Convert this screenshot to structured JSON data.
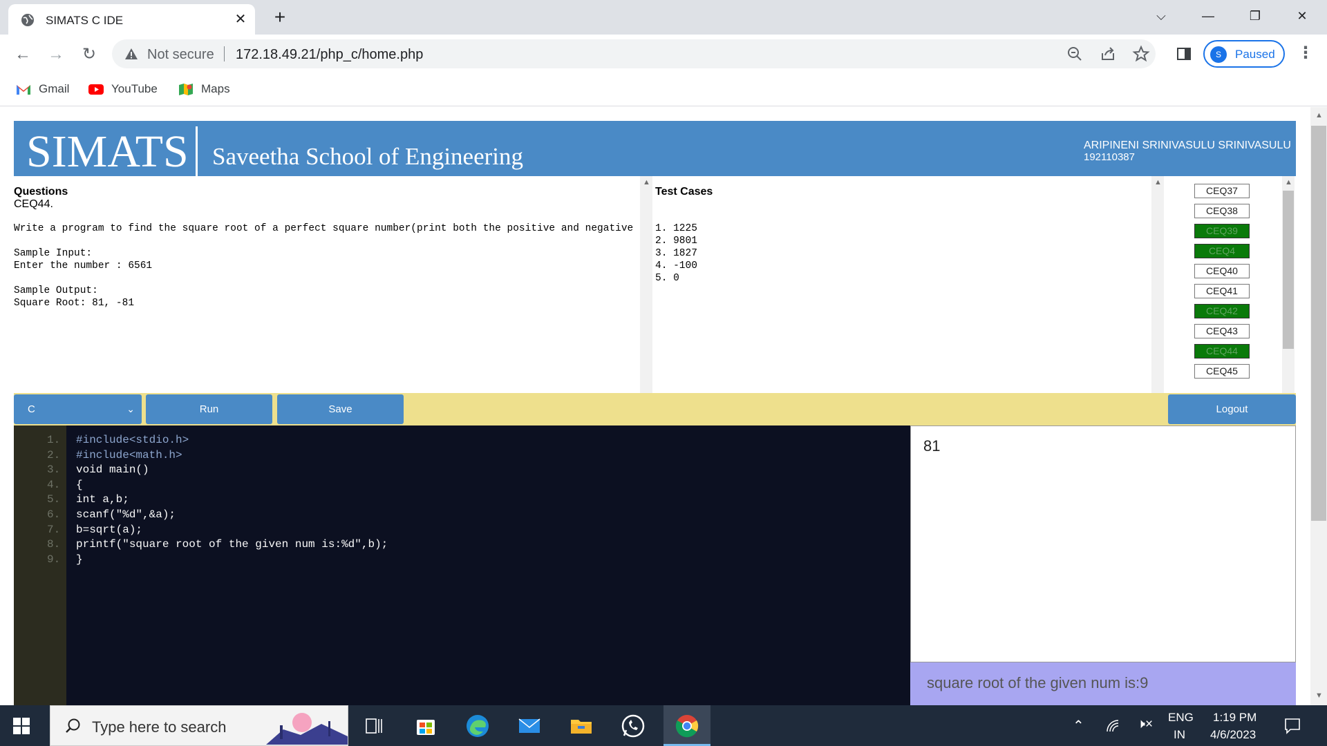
{
  "browser": {
    "tab_title": "SIMATS C IDE",
    "security_label": "Not secure",
    "url": "172.18.49.21/php_c/home.php",
    "profile_initial": "S",
    "profile_status": "Paused",
    "bookmarks": [
      {
        "label": "Gmail"
      },
      {
        "label": "YouTube"
      },
      {
        "label": "Maps"
      }
    ]
  },
  "header": {
    "brand": "SIMATS",
    "subtitle": "Saveetha School of Engineering",
    "user_name": "ARIPINENI SRINIVASULU SRINIVASULU",
    "user_id": "192110387"
  },
  "question": {
    "heading": "Questions",
    "id": "CEQ44.",
    "body": "Write a program to find the square root of a perfect square number(print both the positive and negative v\n\nSample Input:\nEnter the number : 6561\n\nSample Output:\nSquare Root: 81, -81"
  },
  "test_cases": {
    "heading": "Test Cases",
    "items": [
      "1. 1225",
      "2. 9801",
      "3. 1827",
      "4. -100",
      "5. 0"
    ]
  },
  "question_list": [
    {
      "label": "CEQ37",
      "status": "pending"
    },
    {
      "label": "CEQ38",
      "status": "pending"
    },
    {
      "label": "CEQ39",
      "status": "done"
    },
    {
      "label": "CEQ4",
      "status": "done"
    },
    {
      "label": "CEQ40",
      "status": "pending"
    },
    {
      "label": "CEQ41",
      "status": "pending"
    },
    {
      "label": "CEQ42",
      "status": "done"
    },
    {
      "label": "CEQ43",
      "status": "pending"
    },
    {
      "label": "CEQ44",
      "status": "done"
    },
    {
      "label": "CEQ45",
      "status": "pending"
    }
  ],
  "controls": {
    "language": "C",
    "run_label": "Run",
    "save_label": "Save",
    "logout_label": "Logout"
  },
  "editor": {
    "line_numbers": [
      "1.",
      "2.",
      "3.",
      "4.",
      "5.",
      "6.",
      "7.",
      "8.",
      "9."
    ],
    "lines": [
      "#include<stdio.h>",
      "#include<math.h>",
      "void main()",
      "{",
      "int a,b;",
      "scanf(\"%d\",&a);",
      "b=sqrt(a);",
      "printf(\"square root of the given num is:%d\",b);",
      "}"
    ]
  },
  "output": {
    "input_value": "81",
    "result_text": "square root of the given num is:9"
  },
  "taskbar": {
    "search_placeholder": "Type here to search",
    "lang_top": "ENG",
    "lang_bottom": "IN",
    "time": "1:19 PM",
    "date": "4/6/2023"
  },
  "colors": {
    "banner": "#4a8ac6",
    "control_bar": "#eee08d",
    "done_button": "#0a7a0a",
    "editor_bg": "#0c1021",
    "result_bg": "#a8a6f1"
  }
}
